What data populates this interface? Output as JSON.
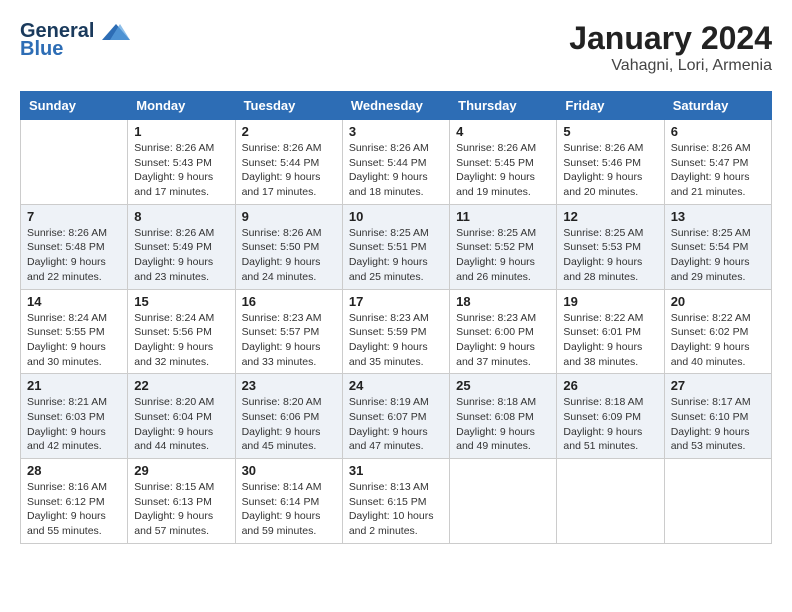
{
  "header": {
    "logo_line1": "General",
    "logo_line2": "Blue",
    "month_title": "January 2024",
    "location": "Vahagni, Lori, Armenia"
  },
  "days_of_week": [
    "Sunday",
    "Monday",
    "Tuesday",
    "Wednesday",
    "Thursday",
    "Friday",
    "Saturday"
  ],
  "weeks": [
    [
      {
        "day": "",
        "sunrise": "",
        "sunset": "",
        "daylight": ""
      },
      {
        "day": "1",
        "sunrise": "Sunrise: 8:26 AM",
        "sunset": "Sunset: 5:43 PM",
        "daylight": "Daylight: 9 hours and 17 minutes."
      },
      {
        "day": "2",
        "sunrise": "Sunrise: 8:26 AM",
        "sunset": "Sunset: 5:44 PM",
        "daylight": "Daylight: 9 hours and 17 minutes."
      },
      {
        "day": "3",
        "sunrise": "Sunrise: 8:26 AM",
        "sunset": "Sunset: 5:44 PM",
        "daylight": "Daylight: 9 hours and 18 minutes."
      },
      {
        "day": "4",
        "sunrise": "Sunrise: 8:26 AM",
        "sunset": "Sunset: 5:45 PM",
        "daylight": "Daylight: 9 hours and 19 minutes."
      },
      {
        "day": "5",
        "sunrise": "Sunrise: 8:26 AM",
        "sunset": "Sunset: 5:46 PM",
        "daylight": "Daylight: 9 hours and 20 minutes."
      },
      {
        "day": "6",
        "sunrise": "Sunrise: 8:26 AM",
        "sunset": "Sunset: 5:47 PM",
        "daylight": "Daylight: 9 hours and 21 minutes."
      }
    ],
    [
      {
        "day": "7",
        "sunrise": "Sunrise: 8:26 AM",
        "sunset": "Sunset: 5:48 PM",
        "daylight": "Daylight: 9 hours and 22 minutes."
      },
      {
        "day": "8",
        "sunrise": "Sunrise: 8:26 AM",
        "sunset": "Sunset: 5:49 PM",
        "daylight": "Daylight: 9 hours and 23 minutes."
      },
      {
        "day": "9",
        "sunrise": "Sunrise: 8:26 AM",
        "sunset": "Sunset: 5:50 PM",
        "daylight": "Daylight: 9 hours and 24 minutes."
      },
      {
        "day": "10",
        "sunrise": "Sunrise: 8:25 AM",
        "sunset": "Sunset: 5:51 PM",
        "daylight": "Daylight: 9 hours and 25 minutes."
      },
      {
        "day": "11",
        "sunrise": "Sunrise: 8:25 AM",
        "sunset": "Sunset: 5:52 PM",
        "daylight": "Daylight: 9 hours and 26 minutes."
      },
      {
        "day": "12",
        "sunrise": "Sunrise: 8:25 AM",
        "sunset": "Sunset: 5:53 PM",
        "daylight": "Daylight: 9 hours and 28 minutes."
      },
      {
        "day": "13",
        "sunrise": "Sunrise: 8:25 AM",
        "sunset": "Sunset: 5:54 PM",
        "daylight": "Daylight: 9 hours and 29 minutes."
      }
    ],
    [
      {
        "day": "14",
        "sunrise": "Sunrise: 8:24 AM",
        "sunset": "Sunset: 5:55 PM",
        "daylight": "Daylight: 9 hours and 30 minutes."
      },
      {
        "day": "15",
        "sunrise": "Sunrise: 8:24 AM",
        "sunset": "Sunset: 5:56 PM",
        "daylight": "Daylight: 9 hours and 32 minutes."
      },
      {
        "day": "16",
        "sunrise": "Sunrise: 8:23 AM",
        "sunset": "Sunset: 5:57 PM",
        "daylight": "Daylight: 9 hours and 33 minutes."
      },
      {
        "day": "17",
        "sunrise": "Sunrise: 8:23 AM",
        "sunset": "Sunset: 5:59 PM",
        "daylight": "Daylight: 9 hours and 35 minutes."
      },
      {
        "day": "18",
        "sunrise": "Sunrise: 8:23 AM",
        "sunset": "Sunset: 6:00 PM",
        "daylight": "Daylight: 9 hours and 37 minutes."
      },
      {
        "day": "19",
        "sunrise": "Sunrise: 8:22 AM",
        "sunset": "Sunset: 6:01 PM",
        "daylight": "Daylight: 9 hours and 38 minutes."
      },
      {
        "day": "20",
        "sunrise": "Sunrise: 8:22 AM",
        "sunset": "Sunset: 6:02 PM",
        "daylight": "Daylight: 9 hours and 40 minutes."
      }
    ],
    [
      {
        "day": "21",
        "sunrise": "Sunrise: 8:21 AM",
        "sunset": "Sunset: 6:03 PM",
        "daylight": "Daylight: 9 hours and 42 minutes."
      },
      {
        "day": "22",
        "sunrise": "Sunrise: 8:20 AM",
        "sunset": "Sunset: 6:04 PM",
        "daylight": "Daylight: 9 hours and 44 minutes."
      },
      {
        "day": "23",
        "sunrise": "Sunrise: 8:20 AM",
        "sunset": "Sunset: 6:06 PM",
        "daylight": "Daylight: 9 hours and 45 minutes."
      },
      {
        "day": "24",
        "sunrise": "Sunrise: 8:19 AM",
        "sunset": "Sunset: 6:07 PM",
        "daylight": "Daylight: 9 hours and 47 minutes."
      },
      {
        "day": "25",
        "sunrise": "Sunrise: 8:18 AM",
        "sunset": "Sunset: 6:08 PM",
        "daylight": "Daylight: 9 hours and 49 minutes."
      },
      {
        "day": "26",
        "sunrise": "Sunrise: 8:18 AM",
        "sunset": "Sunset: 6:09 PM",
        "daylight": "Daylight: 9 hours and 51 minutes."
      },
      {
        "day": "27",
        "sunrise": "Sunrise: 8:17 AM",
        "sunset": "Sunset: 6:10 PM",
        "daylight": "Daylight: 9 hours and 53 minutes."
      }
    ],
    [
      {
        "day": "28",
        "sunrise": "Sunrise: 8:16 AM",
        "sunset": "Sunset: 6:12 PM",
        "daylight": "Daylight: 9 hours and 55 minutes."
      },
      {
        "day": "29",
        "sunrise": "Sunrise: 8:15 AM",
        "sunset": "Sunset: 6:13 PM",
        "daylight": "Daylight: 9 hours and 57 minutes."
      },
      {
        "day": "30",
        "sunrise": "Sunrise: 8:14 AM",
        "sunset": "Sunset: 6:14 PM",
        "daylight": "Daylight: 9 hours and 59 minutes."
      },
      {
        "day": "31",
        "sunrise": "Sunrise: 8:13 AM",
        "sunset": "Sunset: 6:15 PM",
        "daylight": "Daylight: 10 hours and 2 minutes."
      },
      {
        "day": "",
        "sunrise": "",
        "sunset": "",
        "daylight": ""
      },
      {
        "day": "",
        "sunrise": "",
        "sunset": "",
        "daylight": ""
      },
      {
        "day": "",
        "sunrise": "",
        "sunset": "",
        "daylight": ""
      }
    ]
  ]
}
